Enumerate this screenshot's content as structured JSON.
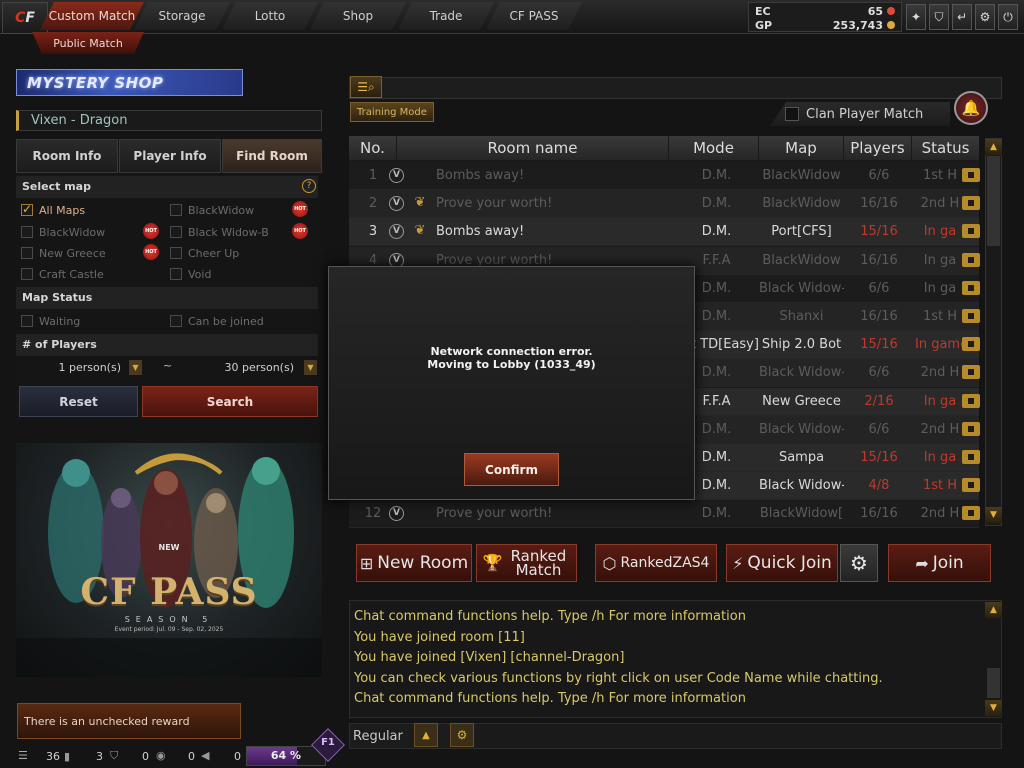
{
  "topbar": {
    "tabs": [
      "Custom Match",
      "Storage",
      "Lotto",
      "Shop",
      "Trade",
      "CF PASS"
    ],
    "subtab": "Public Match",
    "currency": [
      {
        "label": "EC",
        "value": "65",
        "color": "#d94c3a"
      },
      {
        "label": "GP",
        "value": "253,743",
        "color": "#e0a93a"
      }
    ],
    "icons": [
      "gift-icon",
      "shield-icon",
      "return-icon",
      "gear-icon",
      "power-icon"
    ]
  },
  "left": {
    "banner_shop": "MYSTERY SHOP",
    "channel": "Vixen - Dragon",
    "tabs": [
      "Room Info",
      "Player Info",
      "Find Room"
    ],
    "select_map_header": "Select map",
    "maps": [
      {
        "label": "All Maps",
        "checked": true,
        "hot": false
      },
      {
        "label": "BlackWidow",
        "checked": false,
        "hot": true
      },
      {
        "label": "BlackWidow",
        "checked": false,
        "hot": true
      },
      {
        "label": "Black Widow-B",
        "checked": false,
        "hot": true
      },
      {
        "label": "New Greece",
        "checked": false,
        "hot": true
      },
      {
        "label": "Cheer Up",
        "checked": false,
        "hot": false
      },
      {
        "label": "Craft Castle",
        "checked": false,
        "hot": false
      },
      {
        "label": "Void",
        "checked": false,
        "hot": false
      }
    ],
    "hot_label": "HOT",
    "map_status_header": "Map Status",
    "status_options": [
      "Waiting",
      "Can be joined"
    ],
    "players_header": "# of Players",
    "players_min": "1 person(s)",
    "players_sep": "~",
    "players_max": "30 person(s)",
    "reset_label": "Reset",
    "search_label": "Search",
    "promo": {
      "new_label": "NEW",
      "title": "CF PASS",
      "season": "SEASON 5",
      "period": "Event period: Jul. 09 - Sep. 02, 2025"
    },
    "reward_notice": "There is an unchecked reward",
    "status": {
      "count1": "36",
      "count2": "3",
      "count3": "0",
      "count4": "0",
      "count5": "0",
      "progress_value": 64,
      "progress_label": "64 %",
      "hotkey": "F1"
    }
  },
  "right": {
    "training_label": "Training Mode",
    "clan_match_label": "Clan Player Match",
    "table_headers": [
      "No.",
      "Room name",
      "Mode",
      "Map",
      "Players",
      "Status"
    ],
    "rooms": [
      {
        "no": "1",
        "name": "Bombs away!",
        "mode": "D.M.",
        "map": "BlackWidow",
        "players": "6/6",
        "status": "1st H",
        "wings": false,
        "players_red": false,
        "status_red": false,
        "highlight": false
      },
      {
        "no": "2",
        "name": "Prove your worth!",
        "mode": "D.M.",
        "map": "BlackWidow",
        "players": "16/16",
        "status": "2nd H",
        "wings": true,
        "players_red": false,
        "status_red": false,
        "highlight": false
      },
      {
        "no": "3",
        "name": "Bombs away!",
        "mode": "D.M.",
        "map": "Port[CFS]",
        "players": "15/16",
        "status": "In ga",
        "wings": true,
        "players_red": true,
        "status_red": true,
        "highlight": true
      },
      {
        "no": "4",
        "name": "Prove your worth!",
        "mode": "F.F.A",
        "map": "BlackWidow",
        "players": "16/16",
        "status": "In ga",
        "wings": false,
        "players_red": false,
        "status_red": false,
        "highlight": false
      },
      {
        "no": "5",
        "name": "",
        "mode": "D.M.",
        "map": "Black Widow-",
        "players": "6/6",
        "status": "In ga",
        "wings": false,
        "players_red": false,
        "status_red": false,
        "highlight": false
      },
      {
        "no": "6",
        "name": "",
        "mode": "D.M.",
        "map": "Shanxi",
        "players": "16/16",
        "status": "1st H",
        "wings": false,
        "players_red": false,
        "status_red": false,
        "highlight": false
      },
      {
        "no": "7",
        "name": "",
        "mode": "Bot TD[Easy]",
        "map": "Ship 2.0 Bot",
        "players": "15/16",
        "status": "In game",
        "wings": false,
        "players_red": true,
        "status_red": true,
        "highlight": true
      },
      {
        "no": "8",
        "name": "",
        "mode": "D.M.",
        "map": "Black Widow-",
        "players": "6/6",
        "status": "2nd H",
        "wings": false,
        "players_red": false,
        "status_red": false,
        "highlight": false
      },
      {
        "no": "9",
        "name": "Prove your worth!",
        "mode": "F.F.A",
        "map": "New Greece",
        "players": "2/16",
        "status": "In ga",
        "wings": false,
        "players_red": true,
        "status_red": true,
        "highlight": true
      },
      {
        "no": "10",
        "name": "",
        "mode": "D.M.",
        "map": "Black Widow-",
        "players": "6/6",
        "status": "2nd H",
        "wings": true,
        "players_red": false,
        "status_red": false,
        "highlight": false
      },
      {
        "no": "11",
        "name": "",
        "mode": "D.M.",
        "map": "Sampa",
        "players": "15/16",
        "status": "In ga",
        "wings": false,
        "players_red": true,
        "status_red": true,
        "highlight": true
      },
      {
        "no": "12",
        "name": "",
        "mode": "D.M.",
        "map": "Black Widow-",
        "players": "4/8",
        "status": "1st H",
        "wings": false,
        "players_red": true,
        "status_red": true,
        "highlight": true
      },
      {
        "no": "12",
        "name": "Prove your worth!",
        "mode": "D.M.",
        "map": "BlackWidow[",
        "players": "16/16",
        "status": "2nd H",
        "wings": false,
        "players_red": false,
        "status_red": false,
        "highlight": false
      }
    ],
    "actions": {
      "new_room": "New Room",
      "ranked_match": "Ranked Match",
      "ranked_zas": "RankedZAS4",
      "quick_join": "Quick Join",
      "join": "Join"
    },
    "chat_lines": [
      "Chat command functions help. Type /h For more information",
      "You have joined room [11]",
      "You have joined [Vixen] [channel-Dragon]",
      "You can check various functions by right click on user Code Name while chatting.",
      "Chat command functions help. Type /h For more information"
    ],
    "chat_mode": "Regular"
  },
  "modal": {
    "line1": "Network connection error.",
    "line2": "Moving to Lobby (1033_49)",
    "confirm_label": "Confirm"
  }
}
